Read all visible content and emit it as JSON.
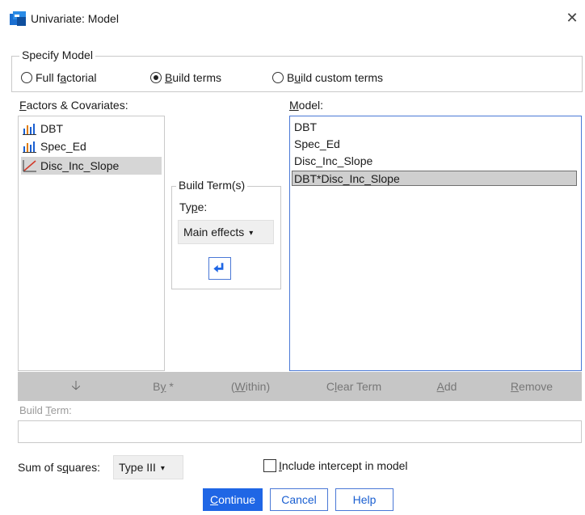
{
  "window": {
    "title": "Univariate: Model",
    "close": "✕"
  },
  "specify_model": {
    "legend": "Specify Model",
    "options": [
      {
        "label": "Full factorial",
        "checked": false
      },
      {
        "label": "Build terms",
        "checked": true
      },
      {
        "label": "Build custom terms",
        "checked": false
      }
    ]
  },
  "factors": {
    "label": "Factors & Covariates:",
    "items": [
      {
        "label": "DBT",
        "icon": "nominal-bar-icon",
        "selected": false
      },
      {
        "label": "Spec_Ed",
        "icon": "nominal-bar-icon",
        "selected": false
      },
      {
        "label": "Disc_Inc_Slope",
        "icon": "scale-line-icon",
        "selected": true
      }
    ]
  },
  "build_terms": {
    "legend": "Build Term(s)",
    "type_label": "Type:",
    "type_value": "Main effects",
    "arrow_icon": "enter-arrow-icon"
  },
  "model": {
    "label": "Model:",
    "items": [
      {
        "label": "DBT",
        "selected": false
      },
      {
        "label": "Spec_Ed",
        "selected": false
      },
      {
        "label": "Disc_Inc_Slope",
        "selected": false
      },
      {
        "label": "DBT*Disc_Inc_Slope",
        "selected": true
      }
    ]
  },
  "toolbar": {
    "down_arrow": "🡣",
    "by": "By *",
    "within": "(Within)",
    "clear_term": "Clear Term",
    "add": "Add",
    "remove": "Remove"
  },
  "build_term_field": {
    "label": "Build Term:",
    "value": ""
  },
  "sum_of_squares": {
    "label": "Sum of squares:",
    "value": "Type III"
  },
  "include_intercept": {
    "label": "Include intercept in model",
    "checked": false
  },
  "buttons": {
    "continue": "Continue",
    "cancel": "Cancel",
    "help": "Help"
  },
  "colors": {
    "accent": "#1f66e5",
    "selected_bg": "#d6d6d6",
    "toolbar_bg": "#c6c6c6"
  }
}
